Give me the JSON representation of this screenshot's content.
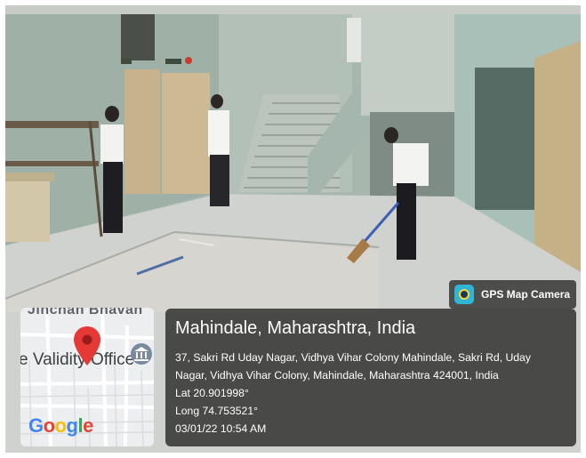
{
  "colors": {
    "wall": "#a9b7ad",
    "floor": "#cfd3cf",
    "overlay": "#232323",
    "map_pin": "#e53935"
  },
  "badge": {
    "icon": "camera-lens-icon",
    "label": "GPS Map Camera"
  },
  "map": {
    "place_label": "Jinchan Bhavan",
    "poi_label": "e Validity Office",
    "pin_icon": "map-pin-icon",
    "poi_icon": "bank-icon",
    "google_letters": [
      "G",
      "o",
      "o",
      "g",
      "l",
      "e"
    ]
  },
  "location": {
    "title": "Mahindale, Maharashtra, India",
    "address_line1": "37, Sakri Rd Uday Nagar, Vidhya Vihar Colony Mahindale, Sakri Rd, Uday",
    "address_line2": "Nagar, Vidhya Vihar Colony, Mahindale, Maharashtra 424001, India",
    "lat": "Lat 20.901998°",
    "long": "Long 74.753521°",
    "datetime": "03/01/22 10:54 AM"
  }
}
